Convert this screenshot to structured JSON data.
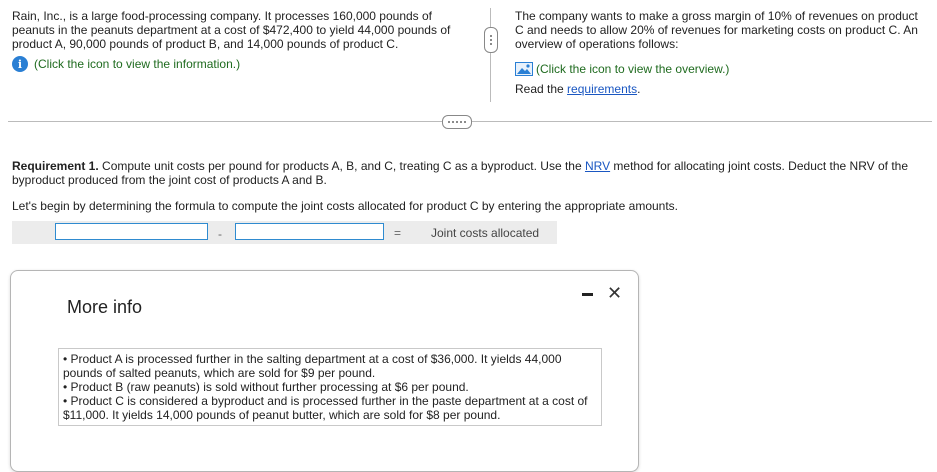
{
  "intro": {
    "text": "Rain, Inc., is a large food-processing company. It processes 160,000 pounds of peanuts in the peanuts department at a cost of $472,400 to yield 44,000 pounds of product A, 90,000 pounds of product B, and 14,000 pounds of product C.",
    "info_link": "(Click the icon to view the information.)"
  },
  "right": {
    "text": "The company wants to make a gross margin of 10% of revenues on product C and needs to allow 20% of revenues for marketing costs on product C. An overview of operations follows:",
    "overview_link": "(Click the icon to view the overview.)",
    "read_prefix": "Read the ",
    "requirements_link": "requirements",
    "read_suffix": "."
  },
  "requirement": {
    "label": "Requirement 1.",
    "text_before": " Compute unit costs per pound for products A, B, and C, treating C as a byproduct. Use the ",
    "nrv": "NRV",
    "text_after": " method for allocating joint costs. Deduct the NRV of the byproduct produced from the joint cost of products A and B."
  },
  "instruction": "Let's begin by determining the formula to compute the joint costs allocated for product C by entering the appropriate amounts.",
  "formula": {
    "input1": "",
    "minus": "-",
    "input2": "",
    "equals": "=",
    "result_label": "Joint costs allocated"
  },
  "more_info": {
    "title": "More info",
    "minimize": "minimize",
    "close": "✕",
    "bullets": [
      "• Product A is processed further in the salting department at a cost of $36,000. It yields 44,000 pounds of salted peanuts, which are sold for $9 per pound.",
      "• Product B (raw peanuts) is sold without further processing at $6 per pound.",
      "• Product C is considered a byproduct and is processed further in the paste department at a cost of $11,000. It yields 14,000 pounds of peanut butter,  which are sold for $8 per pound."
    ]
  },
  "icons": {
    "info": "info-icon",
    "image": "image-icon"
  },
  "colors": {
    "link": "#1a57c2",
    "info_link_text": "#1f6b1f",
    "info_icon": "#2a7fd4",
    "input_border": "#2f8bd0"
  }
}
